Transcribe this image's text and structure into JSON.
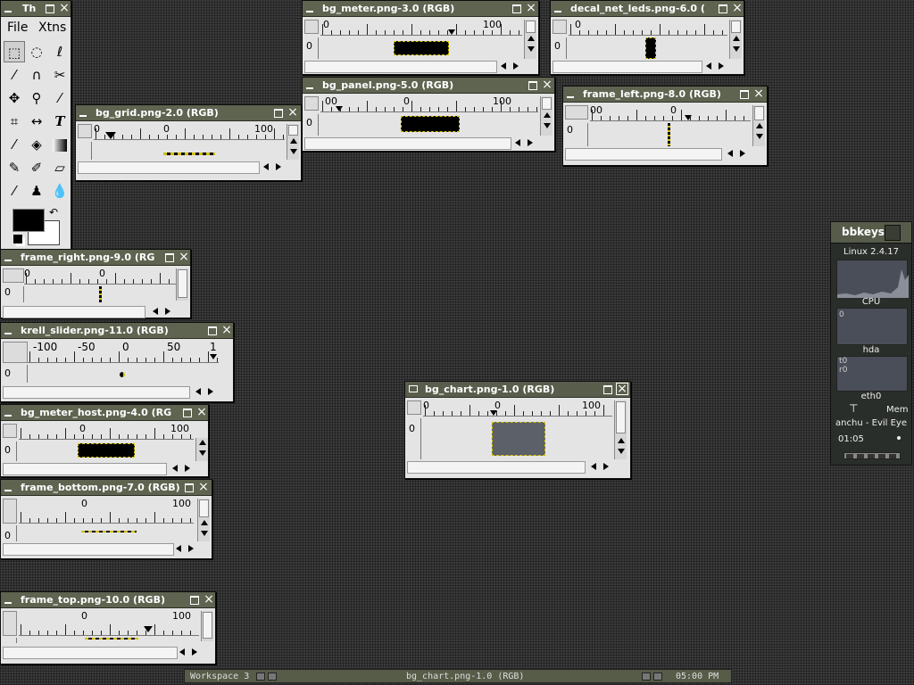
{
  "toolbox": {
    "title": "Th",
    "menu": [
      "File",
      "Xtns"
    ]
  },
  "windows": [
    {
      "id": "bg_meter",
      "title": "bg_meter.png-3.0 (RGB)",
      "ruler": [
        "0",
        "100"
      ]
    },
    {
      "id": "decal_net_leds",
      "title": "decal_net_leds.png-6.0 (",
      "ruler": [
        "0"
      ]
    },
    {
      "id": "bg_panel",
      "title": "bg_panel.png-5.0 (RGB)",
      "ruler": [
        "00",
        "0",
        "100"
      ]
    },
    {
      "id": "frame_left",
      "title": "frame_left.png-8.0 (RGB)",
      "ruler": [
        "00",
        "0"
      ]
    },
    {
      "id": "bg_grid",
      "title": "bg_grid.png-2.0 (RGB)",
      "ruler": [
        "0",
        "0",
        "100"
      ]
    },
    {
      "id": "frame_right",
      "title": "frame_right.png-9.0 (RG",
      "ruler": [
        "0",
        "0"
      ]
    },
    {
      "id": "krell_slider",
      "title": "krell_slider.png-11.0 (RGB)",
      "ruler": [
        "-100",
        "-50",
        "0",
        "50",
        "1"
      ]
    },
    {
      "id": "bg_meter_host",
      "title": "bg_meter_host.png-4.0 (RG",
      "ruler": [
        "0",
        "100"
      ]
    },
    {
      "id": "frame_bottom",
      "title": "frame_bottom.png-7.0 (RGB)",
      "ruler": [
        "0",
        "100"
      ]
    },
    {
      "id": "frame_top",
      "title": "frame_top.png-10.0 (RGB)",
      "ruler": [
        "0",
        "100"
      ]
    },
    {
      "id": "bg_chart",
      "title": "bg_chart.png-1.0 (RGB)",
      "ruler": [
        "0",
        "0",
        "100"
      ]
    }
  ],
  "vruler_label": "0",
  "gkrellm": {
    "title": "bbkeys",
    "host": "Linux 2.4.17",
    "cpu": "CPU",
    "hda": "hda",
    "eth": "eth0",
    "mem": "Mem",
    "song": "anchu - Evil Eye",
    "time": "01:05",
    "chart_zero": "0",
    "hda_top": "t0",
    "hda_bottom": "r0"
  },
  "taskbar": {
    "workspace": "Workspace 3",
    "active_window": "bg_chart.png-1.0 (RGB)",
    "clock": "05:00 PM"
  },
  "colors": {
    "titlebar": "#5e6450",
    "window_body": "#e4e4e4",
    "selection_marching_ants": "#d4c000",
    "desktop": "#3a3a3a"
  }
}
